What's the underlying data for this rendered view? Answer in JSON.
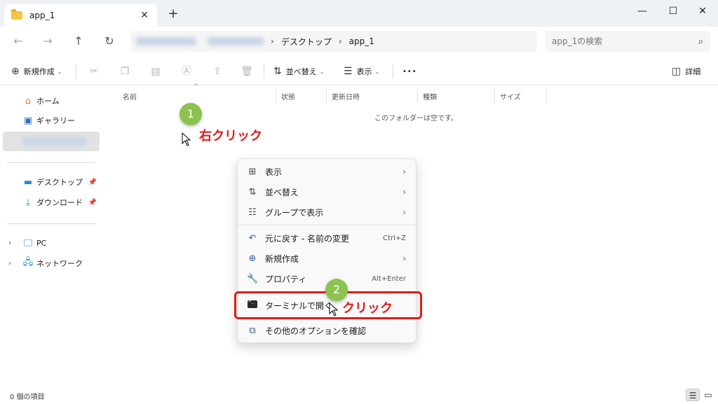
{
  "window": {
    "tab_title": "app_1",
    "tab_close": "✕",
    "new_tab": "+",
    "minimize": "—",
    "maximize": "☐",
    "close": "✕"
  },
  "address": {
    "breadcrumbs": [
      "デスクトップ",
      "app_1"
    ],
    "separator": "›",
    "search_placeholder": "app_1の検索"
  },
  "commandbar": {
    "new_label": "新規作成",
    "sort_label": "並べ替え",
    "view_label": "表示",
    "more_label": "•••",
    "details_label": "詳細"
  },
  "sidebar": {
    "items": [
      {
        "label": "ホーム",
        "icon": "home-icon"
      },
      {
        "label": "ギャラリー",
        "icon": "gallery-icon"
      },
      {
        "label": "デスクトップ",
        "icon": "desktop-icon"
      },
      {
        "label": "ダウンロード",
        "icon": "download-icon"
      },
      {
        "label": "PC",
        "icon": "pc-icon"
      },
      {
        "label": "ネットワーク",
        "icon": "network-icon"
      }
    ]
  },
  "columns": [
    "名前",
    "状態",
    "更新日時",
    "種類",
    "サイズ"
  ],
  "empty_message": "このフォルダーは空です。",
  "status": {
    "item_count": "0 個の項目"
  },
  "context_menu": {
    "items": [
      {
        "label": "表示",
        "icon": "grid-icon",
        "has_submenu": true
      },
      {
        "label": "並べ替え",
        "icon": "sort-icon",
        "has_submenu": true
      },
      {
        "label": "グループで表示",
        "icon": "group-icon",
        "has_submenu": true
      },
      {
        "label": "元に戻す - 名前の変更",
        "icon": "undo-icon",
        "shortcut": "Ctrl+Z"
      },
      {
        "label": "新規作成",
        "icon": "new-icon",
        "has_submenu": true
      },
      {
        "label": "プロパティ",
        "icon": "wrench-icon",
        "shortcut": "Alt+Enter"
      },
      {
        "label": "ターミナルで開く",
        "icon": "terminal-icon"
      },
      {
        "label": "その他のオプションを確認",
        "icon": "more-options-icon"
      }
    ]
  },
  "annotations": {
    "step1_number": "1",
    "step1_text": "右クリック",
    "step2_number": "2",
    "step2_text": "クリック",
    "step_color": "#8cc24f",
    "highlight_color": "#e41b1b"
  }
}
